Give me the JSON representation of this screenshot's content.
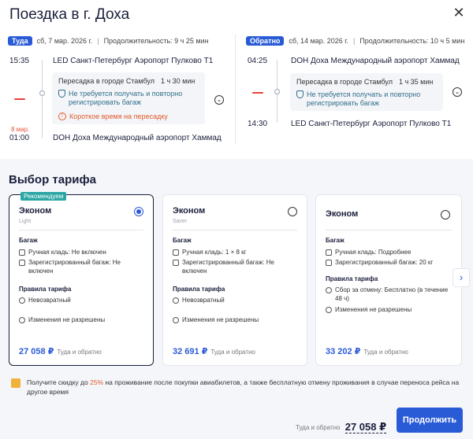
{
  "title": "Поездка в г. Доха",
  "close_icon": "close-icon",
  "outbound": {
    "badge": "Туда",
    "date": "сб, 7 мар. 2026 г.",
    "duration": "Продолжительность: 9 ч 25 мин",
    "dep_time": "15:35",
    "dep_airport": "LED Санкт-Петербург Аэропорт Пулково Т1",
    "transfer_city": "Пересадка в городе Стамбул",
    "transfer_time": "1 ч 30 мин",
    "transfer_note": "Не требуется получать и повторно регистрировать багаж",
    "transfer_warning": "Короткое время на пересадку",
    "arr_date_note": "8 мар.",
    "arr_time": "01:00",
    "arr_airport": "DOH Доха Международный аэропорт Хаммад"
  },
  "return": {
    "badge": "Обратно",
    "date": "сб, 14 мар. 2026 г.",
    "duration": "Продолжительность: 10 ч 5 мин",
    "dep_time": "04:25",
    "dep_airport": "DOH Доха Международный аэропорт Хаммад",
    "transfer_city": "Пересадка в городе Стамбул",
    "transfer_time": "1 ч 35 мин",
    "transfer_note": "Не требуется получать и повторно регистрировать багаж",
    "arr_time": "14:30",
    "arr_airport": "LED Санкт-Петербург Аэропорт Пулково Т1"
  },
  "tariffs": {
    "title": "Выбор тарифа",
    "cards": [
      {
        "recommended": "Рекомендуем",
        "name": "Эконом",
        "sub": "Light",
        "selected": true,
        "baggage_title": "Багаж",
        "baggage": [
          "Ручная кладь: Не включен",
          "Зарегистрированный багаж: Не включен"
        ],
        "rules_title": "Правила тарифа",
        "rules": [
          "Невозвратный",
          "Изменения не разрешены"
        ],
        "price": "27 058 ₽",
        "price_note": "Туда и обратно"
      },
      {
        "name": "Эконом",
        "sub": "Saver",
        "selected": false,
        "baggage_title": "Багаж",
        "baggage": [
          "Ручная кладь: 1 × 8 кг",
          "Зарегистрированный багаж: Не включен"
        ],
        "rules_title": "Правила тарифа",
        "rules": [
          "Невозвратный",
          "Изменения не разрешены"
        ],
        "price": "32 691 ₽",
        "price_note": "Туда и обратно"
      },
      {
        "name": "Эконом",
        "sub": "",
        "selected": false,
        "baggage_title": "Багаж",
        "baggage": [
          "Ручная кладь: Подробнее",
          "Зарегистрированный багаж: 20 кг"
        ],
        "rules_title": "Правила тарифа",
        "rules": [
          "Сбор за отмену: Бесплатно (в течение 48 ч)",
          "Изменения не разрешены"
        ],
        "price": "33 202 ₽",
        "price_note": "Туда и обратно"
      }
    ]
  },
  "promo": {
    "before": "Получите скидку до",
    "pct": "25%",
    "after": "на проживание после покупки авиабилетов, а также бесплатную отмену проживания в случае переноса рейса на другое время"
  },
  "footer": {
    "total_label": "Туда и обратно",
    "total": "27 058 ₽",
    "continue_label": "Продолжить"
  },
  "colors": {
    "accent": "#2a5bd7",
    "recommended": "#2aa6a4",
    "warning": "#e05a2e"
  }
}
